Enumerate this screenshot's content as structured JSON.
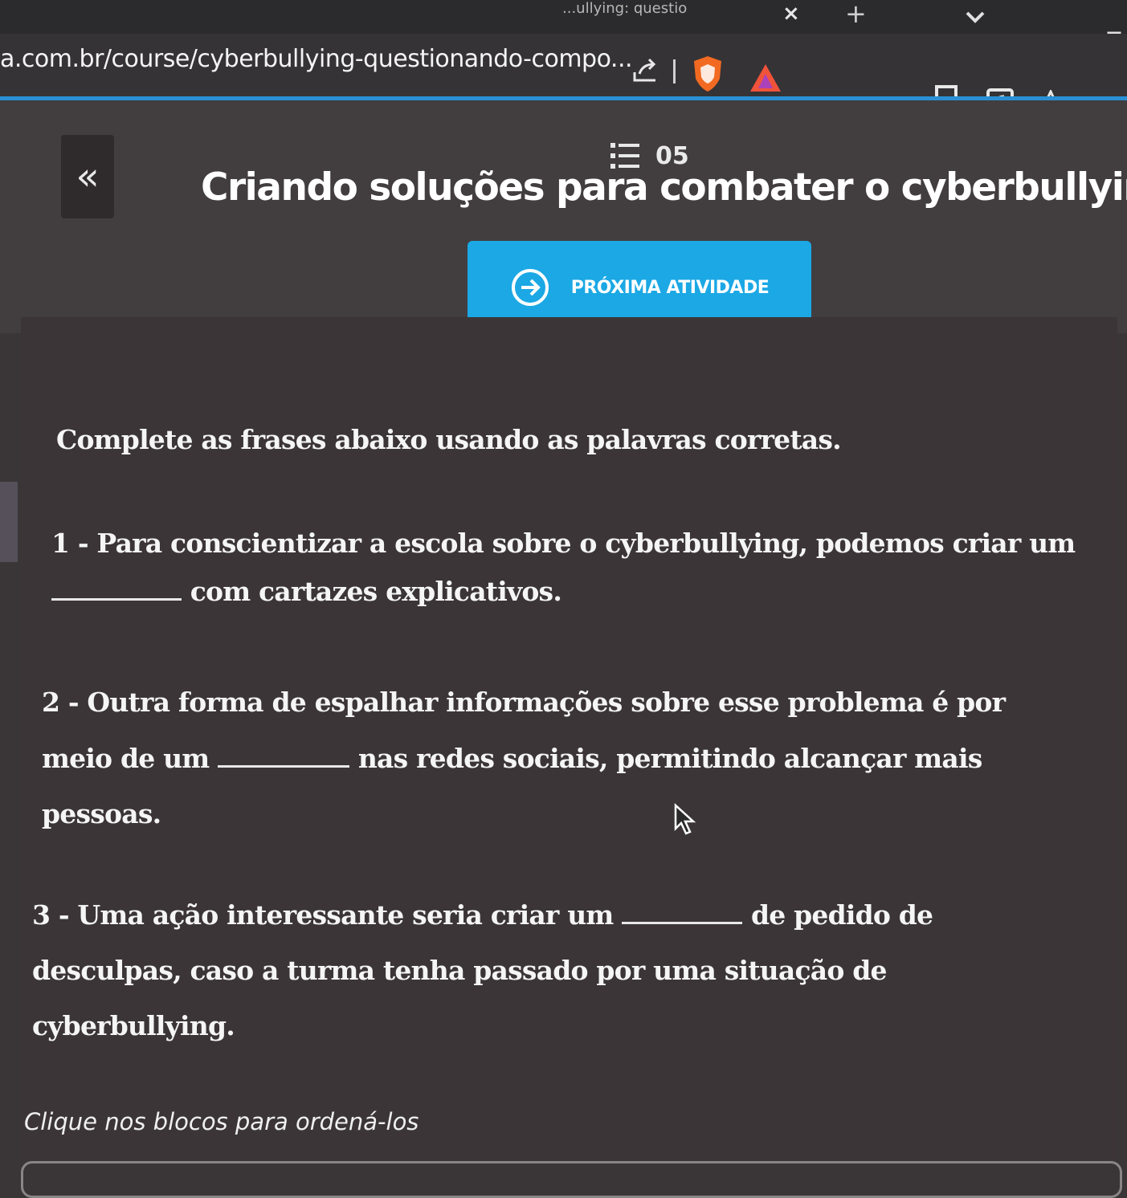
{
  "browser": {
    "tab_title": "...ullying: questio",
    "tab_close": "×",
    "tab_new": "+",
    "url": "a.com.br/course/cyberbullying-questionando-compo...",
    "extension_icons": [
      "share-icon",
      "brave-shield-icon",
      "brave-rewards-icon",
      "reader-mode-icon",
      "screenshot-icon",
      "favorite-icon",
      "profile-icon"
    ],
    "accent_color": "#2a8fd4"
  },
  "header": {
    "back_label": "«",
    "lesson_number": "05",
    "title": "Criando soluções para combater o cyberbullying",
    "next_button": "PRÓXIMA ATIVIDADE",
    "next_button_color": "#1ba8e5"
  },
  "activity": {
    "instruction": "Complete as frases abaixo usando as palavras corretas.",
    "q1": {
      "before": "1 - Para conscientizar a escola sobre o cyberbullying, podemos criar um",
      "after": "com cartazes explicativos."
    },
    "q2": {
      "line1": "2 - Outra forma de espalhar informações sobre esse problema é por",
      "before": "meio de um",
      "after": "nas redes sociais, permitindo alcançar mais",
      "line3": "pessoas."
    },
    "q3": {
      "before": "3 - Uma ação interessante seria criar um",
      "after": "de pedido de",
      "line2": "desculpas, caso a turma tenha passado por uma situação de",
      "line3": "cyberbullying."
    },
    "hint": "Clique nos blocos para ordená-los"
  }
}
